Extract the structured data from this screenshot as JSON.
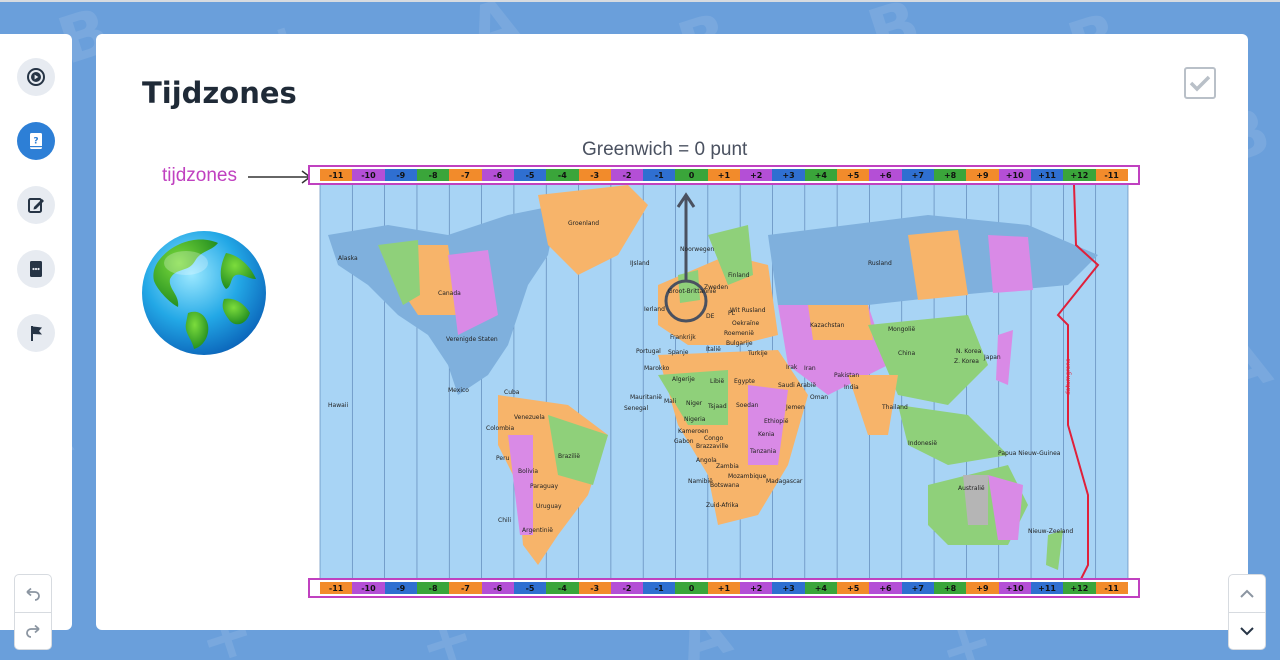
{
  "lesson": {
    "title": "Tijdzones"
  },
  "figure": {
    "greenwich_label": "Greenwich = 0 punt",
    "timezones_label": "tijdzones",
    "dateline_label": "datumgrens",
    "zones": [
      "-11",
      "-10",
      "-9",
      "-8",
      "-7",
      "-6",
      "-5",
      "-4",
      "-3",
      "-2",
      "-1",
      "0",
      "+1",
      "+2",
      "+3",
      "+4",
      "+5",
      "+6",
      "+7",
      "+8",
      "+9",
      "+10",
      "+11",
      "+12",
      "-11"
    ],
    "zone_colors": [
      "#f28b2b",
      "#b44fd6",
      "#2f6fd1",
      "#3aa53a",
      "#f28b2b",
      "#b44fd6",
      "#2f6fd1",
      "#3aa53a",
      "#f28b2b",
      "#b44fd6",
      "#2f6fd1",
      "#3aa53a",
      "#f28b2b",
      "#b44fd6",
      "#2f6fd1",
      "#3aa53a",
      "#f28b2b",
      "#b44fd6",
      "#2f6fd1",
      "#3aa53a",
      "#f28b2b",
      "#b44fd6",
      "#2f6fd1",
      "#3aa53a",
      "#f28b2b"
    ],
    "place_labels": [
      "Alaska",
      "Canada",
      "Groenland",
      "IJsland",
      "Noorwegen",
      "Finland",
      "Zweden",
      "Groot-Brittannië",
      "Ierland",
      "Wit Rusland",
      "Oekraïne",
      "Rusland",
      "Kazachstan",
      "Mongolië",
      "China",
      "N. Korea",
      "Z. Korea",
      "Japan",
      "Verenigde Staten",
      "Mexico",
      "Cuba",
      "Hawaii",
      "Portugal",
      "Spanje",
      "Frankrijk",
      "Italië",
      "Marokko",
      "Algerije",
      "Libië",
      "Egypte",
      "Roemenië",
      "Bulgarije",
      "Turkije",
      "Irak",
      "Iran",
      "Saudi Arabië",
      "Oman",
      "Jemen",
      "Pakistan",
      "India",
      "Thailand",
      "Mauritanië",
      "Senegal",
      "Mali",
      "Niger",
      "Tsjaad",
      "Soedan",
      "Nigeria",
      "Ethiopië",
      "Kameroen",
      "Gabon",
      "Congo",
      "Brazzaville",
      "Kenia",
      "Tanzania",
      "Angola",
      "Zambia",
      "Mozambique",
      "Madagascar",
      "Namibië",
      "Botswana",
      "Zuid-Afrika",
      "Venezuela",
      "Colombia",
      "Peru",
      "Brazilië",
      "Bolivia",
      "Paraguay",
      "Uruguay",
      "Chili",
      "Argentinië",
      "Indonesië",
      "Papua Nieuw-Guinea",
      "Australië",
      "Nieuw-Zeeland",
      "PL",
      "DE"
    ],
    "colors": {
      "ocean": "#a8d4f5",
      "highlight": "#c041c0"
    }
  },
  "sidebar": {
    "items": [
      {
        "icon": "play-circle-icon"
      },
      {
        "icon": "book-question-icon"
      },
      {
        "icon": "edit-icon"
      },
      {
        "icon": "chat-book-icon"
      },
      {
        "icon": "flag-icon"
      }
    ]
  }
}
